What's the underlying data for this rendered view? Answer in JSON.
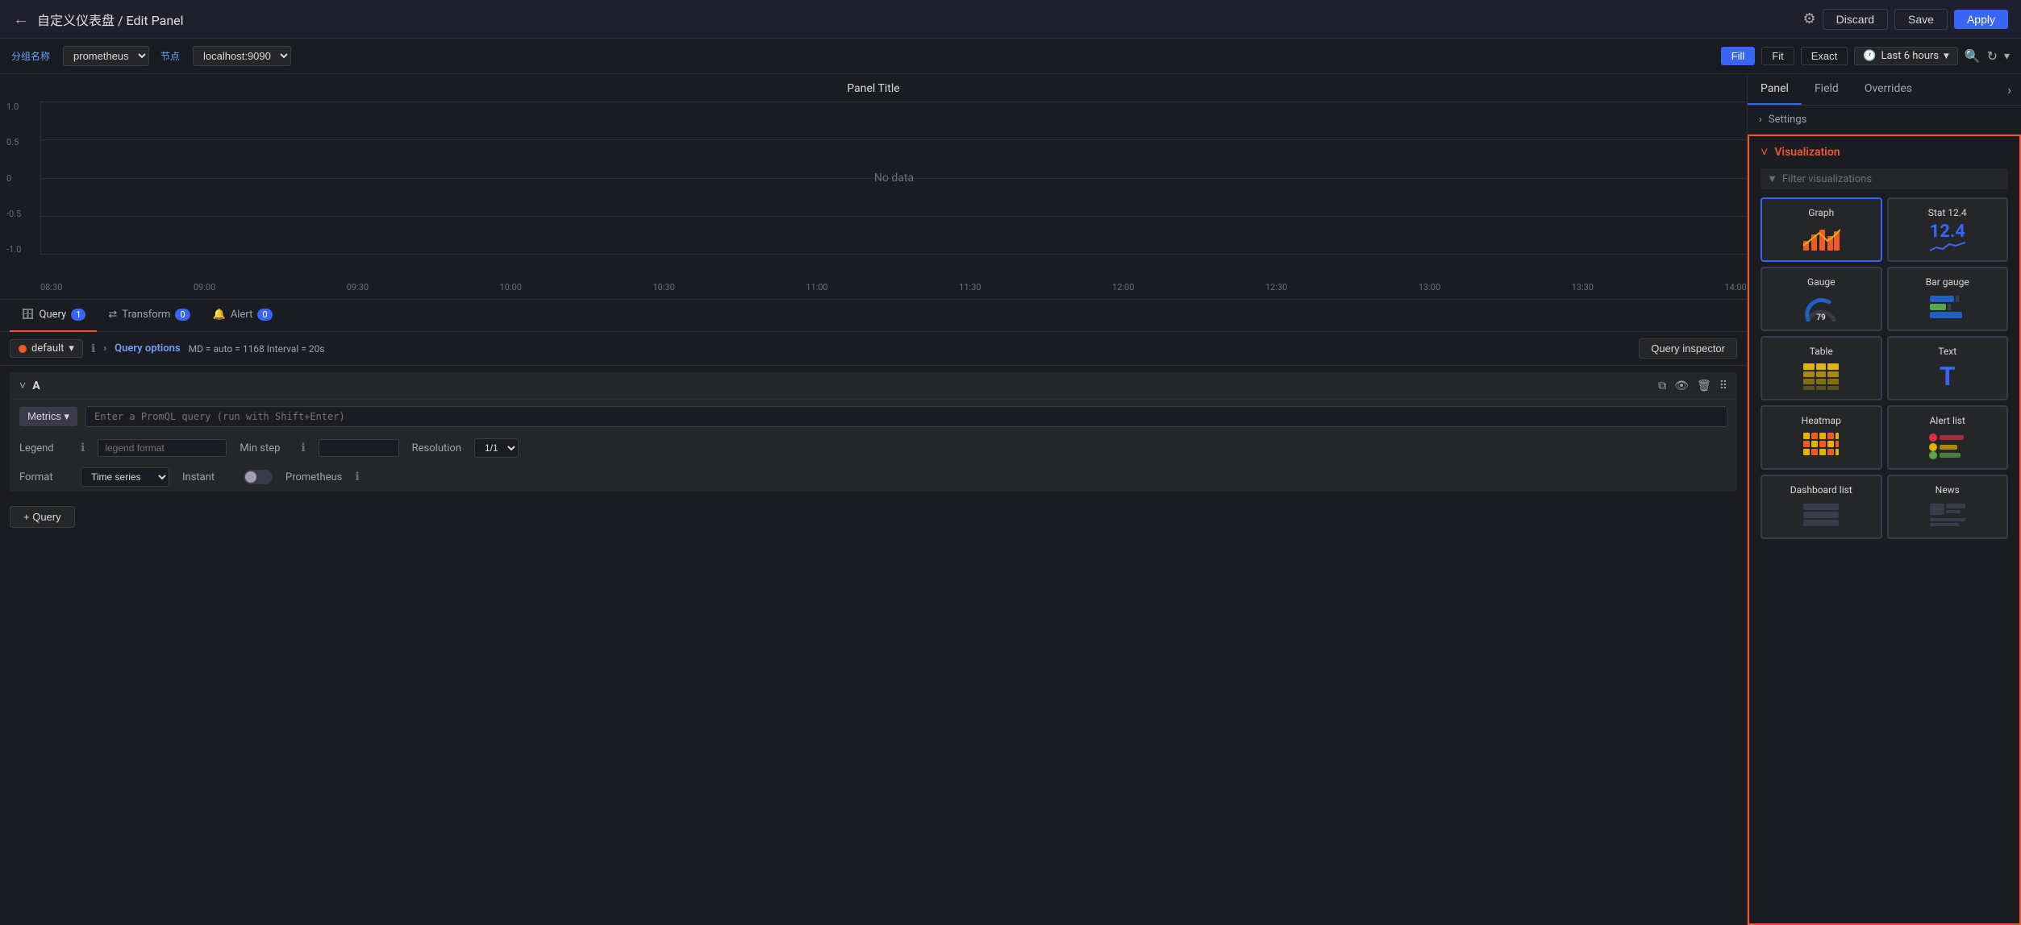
{
  "topbar": {
    "back_icon": "←",
    "title": "自定义仪表盘 / Edit Panel",
    "gear_icon": "⚙",
    "discard_label": "Discard",
    "save_label": "Save",
    "apply_label": "Apply"
  },
  "subbar": {
    "datasource_label": "分组名称",
    "datasource_value": "prometheus",
    "node_label": "节点",
    "node_value": "localhost:9090",
    "view_fill": "Fill",
    "view_fit": "Fit",
    "view_exact": "Exact",
    "time_icon": "🕐",
    "time_range": "Last 6 hours",
    "zoom_icon": "🔍",
    "refresh_icon": "↻",
    "chevron_icon": "▾"
  },
  "chart": {
    "title": "Panel Title",
    "no_data": "No data",
    "y_axis": [
      "1.0",
      "0.5",
      "0",
      "-0.5",
      "-1.0"
    ],
    "x_axis": [
      "08:30",
      "09:00",
      "09:30",
      "10:00",
      "10:30",
      "11:00",
      "11:30",
      "12:00",
      "12:30",
      "13:00",
      "13:30",
      "14:00"
    ]
  },
  "tabs": {
    "query": "Query",
    "query_badge": "1",
    "transform": "Transform",
    "transform_badge": "0",
    "alert": "Alert",
    "alert_badge": "0"
  },
  "query_bar": {
    "datasource": "default",
    "chevron": "▾",
    "info_icon": "ℹ",
    "query_options_label": "Query options",
    "meta": "MD = auto = 1168   Interval = 20s",
    "inspector_label": "Query inspector"
  },
  "query_block": {
    "label": "A",
    "metrics_label": "Metrics ▾",
    "promql_placeholder": "Enter a PromQL query (run with Shift+Enter)",
    "legend_label": "Legend",
    "legend_placeholder": "legend format",
    "min_step_label": "Min step",
    "resolution_label": "Resolution",
    "resolution_value": "1/1",
    "format_label": "Format",
    "format_value": "Time series",
    "instant_label": "Instant",
    "prometheus_label": "Prometheus"
  },
  "add_query": {
    "label": "+ Query"
  },
  "right_panel": {
    "tab_panel": "Panel",
    "tab_field": "Field",
    "tab_overrides": "Overrides",
    "chevron": "›",
    "settings_label": "Settings",
    "settings_chevron": "›",
    "viz_label": "Visualization",
    "viz_chevron": "ˇ",
    "filter_placeholder": "Filter visualizations",
    "filter_icon": "▼",
    "visualizations": [
      {
        "name": "Graph",
        "type": "graph",
        "selected": true
      },
      {
        "name": "Stat 12.4",
        "type": "stat",
        "selected": false
      },
      {
        "name": "Gauge",
        "type": "gauge",
        "selected": false
      },
      {
        "name": "Bar gauge",
        "type": "bargauge",
        "selected": false
      },
      {
        "name": "Table",
        "type": "table",
        "selected": false
      },
      {
        "name": "Text",
        "type": "text",
        "selected": false
      },
      {
        "name": "Heatmap",
        "type": "heatmap",
        "selected": false
      },
      {
        "name": "Alert list",
        "type": "alertlist",
        "selected": false
      },
      {
        "name": "Dashboard list",
        "type": "dashlist",
        "selected": false
      },
      {
        "name": "News",
        "type": "news",
        "selected": false
      }
    ]
  },
  "colors": {
    "accent_blue": "#3865f5",
    "accent_orange": "#f05a28",
    "graph_orange": "#f05a28",
    "graph_yellow": "#e0b400",
    "graph_green": "#56a64b",
    "stat_blue": "#3865f5",
    "gauge_blue": "#1f60c4",
    "bargauge_blue": "#1f60c4",
    "bargauge_green": "#56a64b",
    "bargauge_orange": "#f05a28",
    "table_yellow": "#e0b400",
    "text_blue": "#3865f5",
    "heatmap_orange": "#f05a28",
    "heatmap_yellow": "#e0b400",
    "alertlist_red": "#e02f44",
    "alertlist_yellow": "#e0b400",
    "alertlist_green": "#56a64b"
  }
}
